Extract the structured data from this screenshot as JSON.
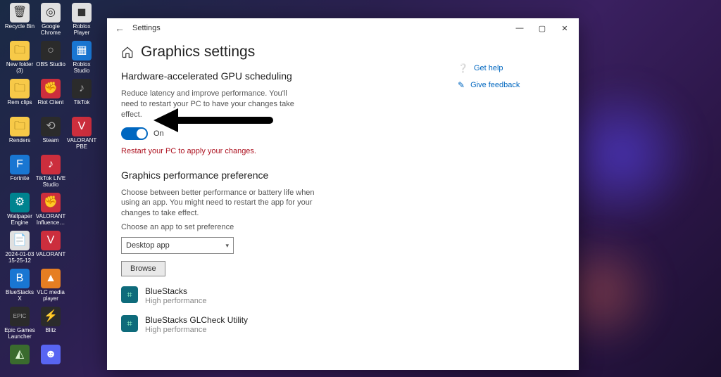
{
  "desktop_icons": [
    {
      "label": "Recycle Bin",
      "style": "white",
      "glyph": "🗑"
    },
    {
      "label": "Google Chrome",
      "style": "white",
      "glyph": "◎"
    },
    {
      "label": "Roblox Player",
      "style": "white",
      "glyph": "◼"
    },
    {
      "label": "New folder (3)",
      "style": "folder",
      "glyph": "🗀"
    },
    {
      "label": "OBS Studio",
      "style": "dark",
      "glyph": "○"
    },
    {
      "label": "Roblox Studio",
      "style": "blue",
      "glyph": "▦"
    },
    {
      "label": "Rem clips",
      "style": "folder",
      "glyph": "🗀"
    },
    {
      "label": "Riot Client",
      "style": "red",
      "glyph": "✊"
    },
    {
      "label": "TikTok",
      "style": "dark",
      "glyph": "♪"
    },
    {
      "label": "Renders",
      "style": "folder",
      "glyph": "🗀"
    },
    {
      "label": "Steam",
      "style": "dark",
      "glyph": "⟲"
    },
    {
      "label": "VALORANT PBE",
      "style": "red",
      "glyph": "V"
    },
    {
      "label": "Fortnite",
      "style": "blue",
      "glyph": "F"
    },
    {
      "label": "TikTok LIVE Studio",
      "style": "red",
      "glyph": "♪"
    },
    {
      "label": "",
      "style": "",
      "glyph": ""
    },
    {
      "label": "Wallpaper Engine",
      "style": "teal",
      "glyph": "⚙"
    },
    {
      "label": "VALORANT Influence…",
      "style": "red",
      "glyph": "✊"
    },
    {
      "label": "",
      "style": "",
      "glyph": ""
    },
    {
      "label": "2024-01-03 15-25-12",
      "style": "white",
      "glyph": "📄"
    },
    {
      "label": "VALORANT",
      "style": "red",
      "glyph": "V"
    },
    {
      "label": "",
      "style": "",
      "glyph": ""
    },
    {
      "label": "BlueStacks X",
      "style": "blue",
      "glyph": "B"
    },
    {
      "label": "VLC media player",
      "style": "orange",
      "glyph": "▲"
    },
    {
      "label": "",
      "style": "",
      "glyph": ""
    },
    {
      "label": "Epic Games Launcher",
      "style": "dark",
      "glyph": "EPIC"
    },
    {
      "label": "Blitz",
      "style": "dark",
      "glyph": "⚡"
    },
    {
      "label": "",
      "style": "",
      "glyph": ""
    },
    {
      "label": "",
      "style": "green",
      "glyph": "◭"
    },
    {
      "label": "",
      "style": "purple",
      "glyph": "☻"
    }
  ],
  "window": {
    "title": "Settings",
    "page_title": "Graphics settings",
    "section1": {
      "heading": "Hardware-accelerated GPU scheduling",
      "desc": "Reduce latency and improve performance. You'll need to restart your PC to have your changes take effect.",
      "toggle_state": "On",
      "restart_msg": "Restart your PC to apply your changes."
    },
    "section2": {
      "heading": "Graphics performance preference",
      "desc": "Choose between better performance or battery life when using an app. You might need to restart the app for your changes to take effect.",
      "choose_label": "Choose an app to set preference",
      "select_value": "Desktop app",
      "browse_label": "Browse"
    },
    "apps": [
      {
        "name": "BlueStacks",
        "pref": "High performance"
      },
      {
        "name": "BlueStacks GLCheck Utility",
        "pref": "High performance"
      }
    ],
    "side_links": {
      "help": "Get help",
      "feedback": "Give feedback"
    }
  }
}
